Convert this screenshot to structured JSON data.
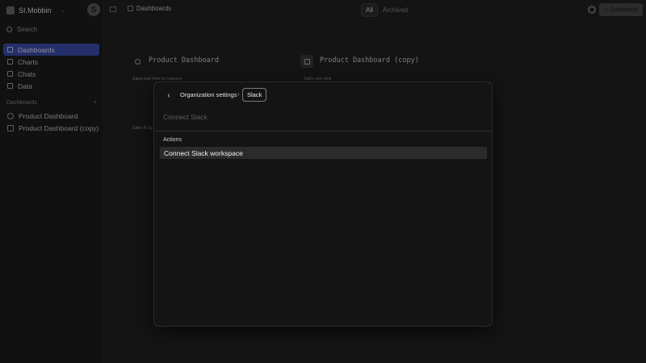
{
  "app": {
    "workspace_name": "SI.Mobbin",
    "logo_letter": "S",
    "breadcrumb": "Dashboards",
    "filters": [
      "All",
      "Archived"
    ],
    "add_button_label": "Dashboard"
  },
  "sidebar": {
    "search_label": "Search",
    "nav": [
      {
        "label": "Dashboards",
        "active": true
      },
      {
        "label": "Charts",
        "active": false
      },
      {
        "label": "Chats",
        "active": false
      },
      {
        "label": "Data",
        "active": false
      }
    ],
    "dashboards_header": "Dashboards",
    "add_symbol": "+",
    "dashboards": [
      "Product Dashboard",
      "Product Dashboard (copy)"
    ]
  },
  "cards": [
    {
      "title": "Product Dashboard",
      "chart1": "Sales over time by category",
      "chart2": "Sales % by"
    },
    {
      "title": "Product Dashboard (copy)",
      "chart1": "Sales over time"
    }
  ],
  "modal": {
    "breadcrumb_parent": "Organization settings",
    "breadcrumb_separator": "›",
    "breadcrumb_current": "Slack",
    "input_placeholder": "Connect Slack",
    "group_label": "Actions",
    "options": [
      "Connect Slack workspace"
    ]
  },
  "colors": {
    "accent": "#3d4fb2",
    "background": "#1b1b1b",
    "modal_bg": "#141414"
  }
}
